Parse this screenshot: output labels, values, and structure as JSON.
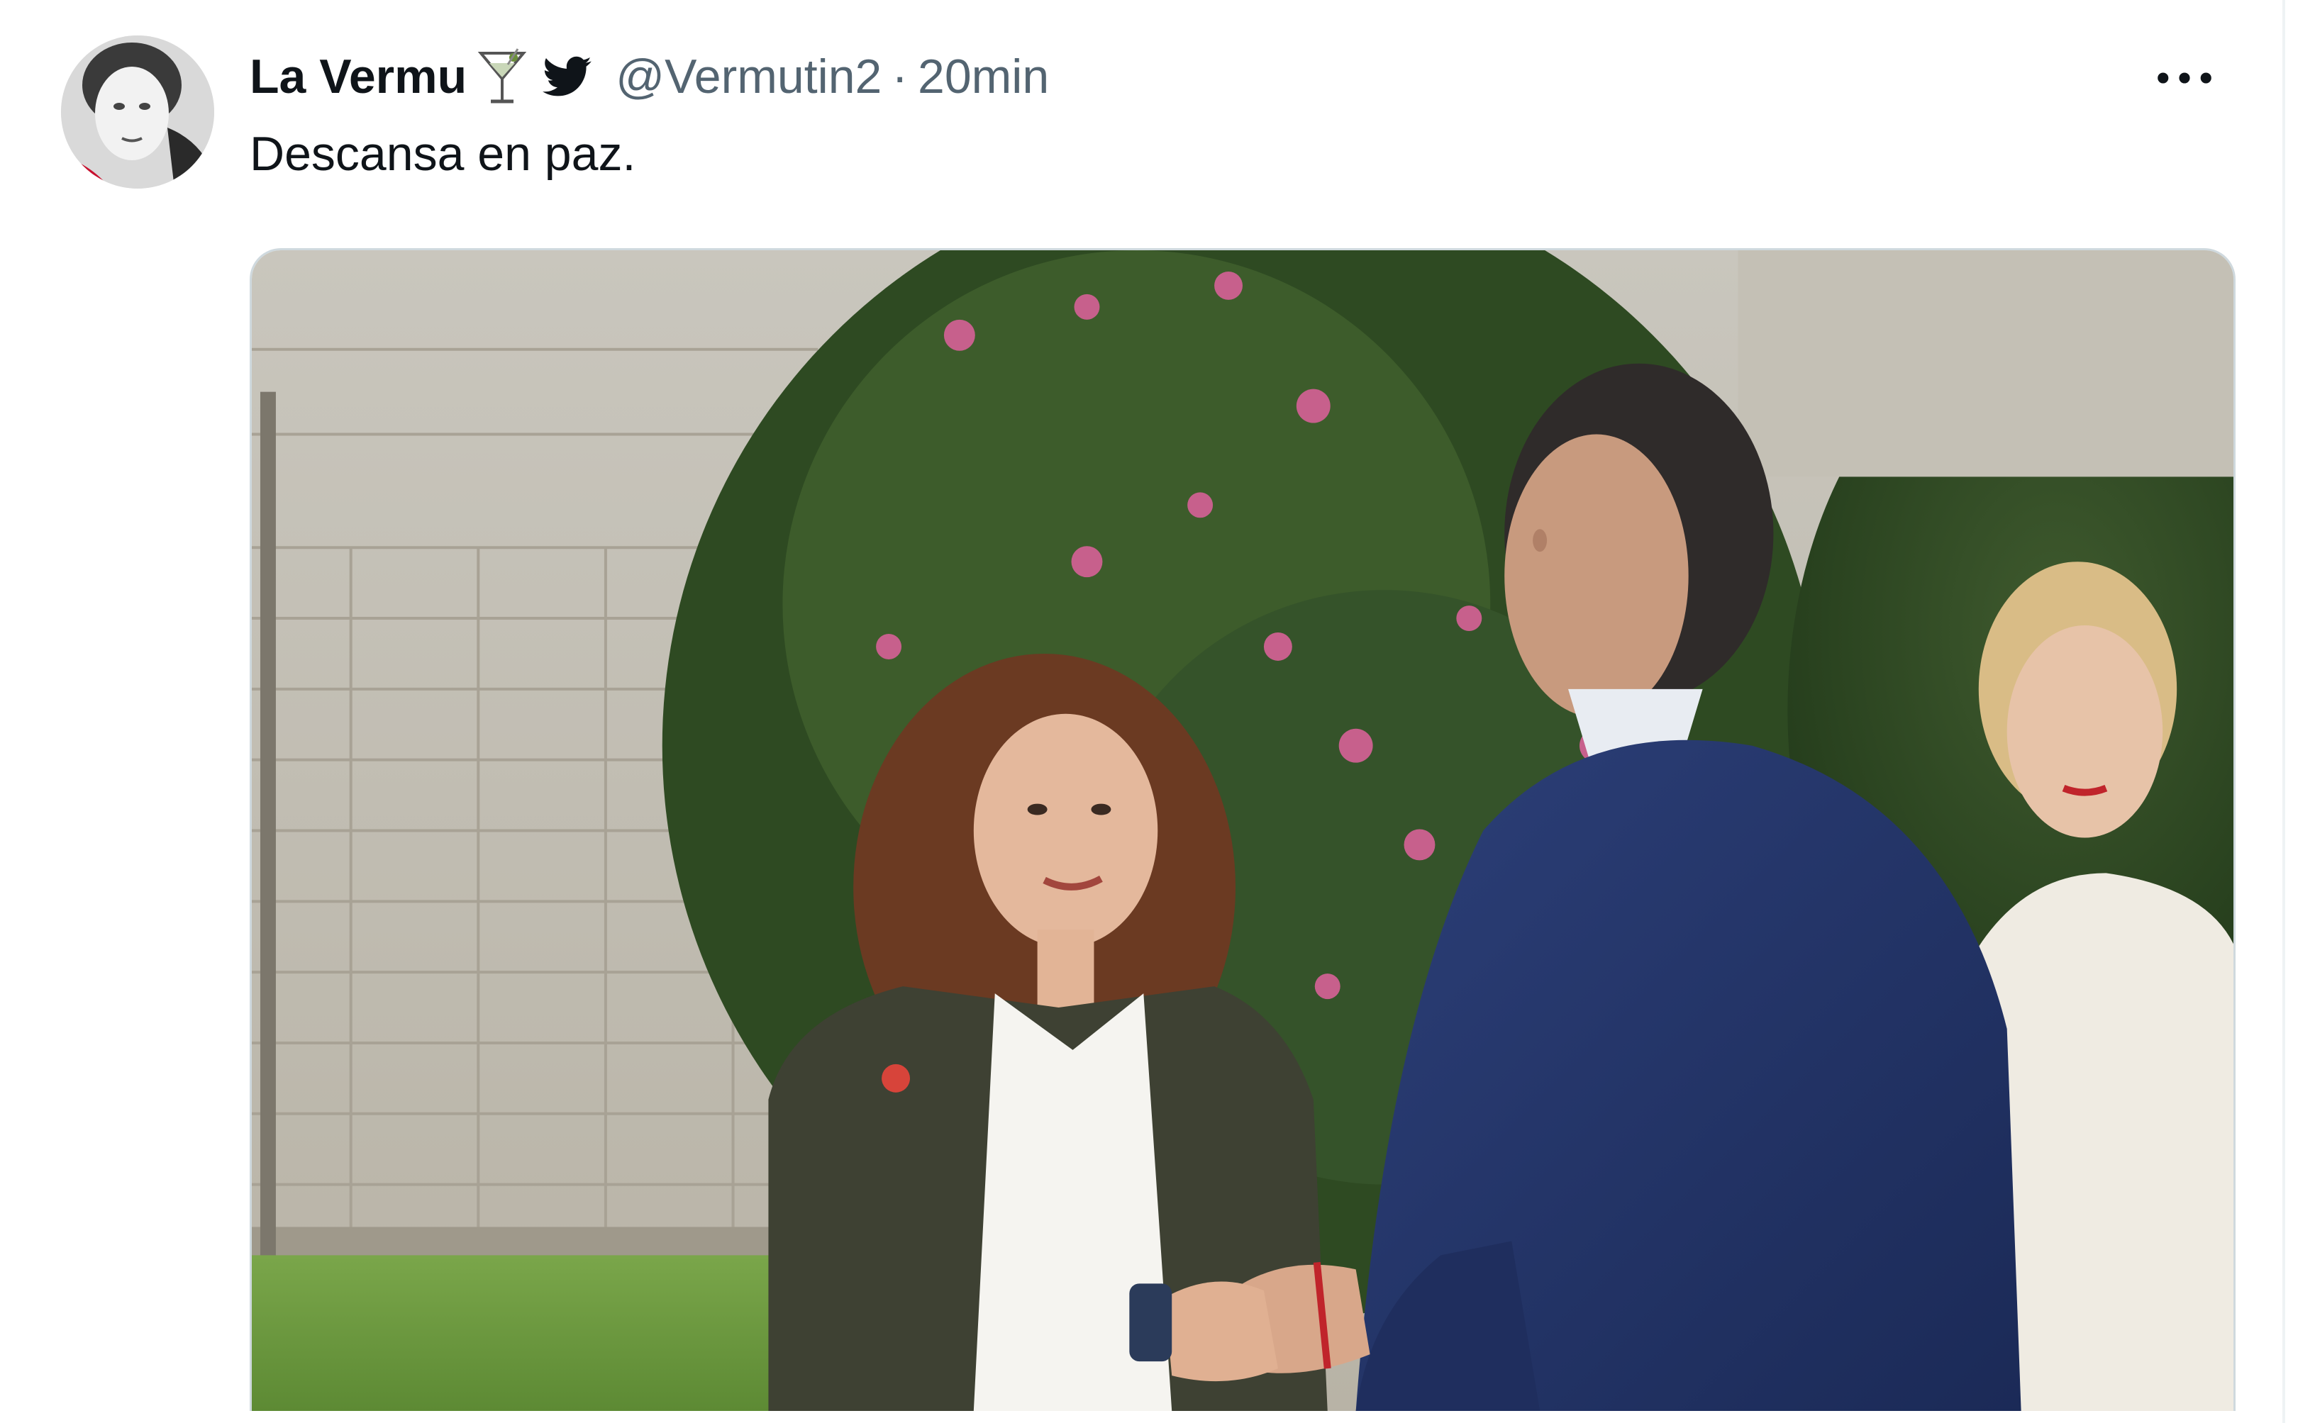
{
  "tweet": {
    "display_name": "La Vermu",
    "name_emoji_icon": "cocktail-glass-icon",
    "verified_icon": "twitter-bird-icon",
    "handle": "@Vermutin2",
    "separator": "·",
    "timestamp": "20min",
    "more_icon": "more-horizontal-icon",
    "text": "Descansa en paz."
  },
  "colors": {
    "text_primary": "#0f1419",
    "text_secondary": "#536471",
    "border": "#cfd9de",
    "background": "#ffffff"
  }
}
